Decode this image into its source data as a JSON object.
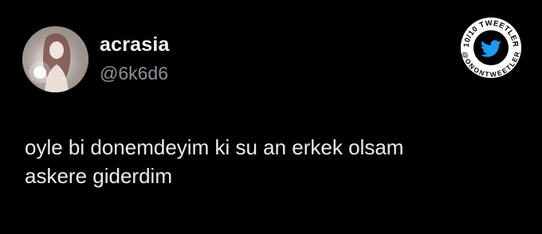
{
  "tweet": {
    "author": {
      "display_name": "acrasia",
      "handle": "@6k6d6",
      "avatar": "profile-photo"
    },
    "text_lines": [
      "oyle bi donemdeyim ki su an erkek olsam",
      "askere giderdim"
    ]
  },
  "watermark": {
    "top_text": "10/10 TWEETLER",
    "bottom_text": "@ONONTWEETLER",
    "icon": "twitter-bird-icon",
    "ring_color": "#ffffff",
    "bird_color": "#1d9bf0"
  },
  "colors": {
    "background": "#000000",
    "name": "#f2f2f2",
    "handle": "#8b9196",
    "text": "#ececec"
  }
}
